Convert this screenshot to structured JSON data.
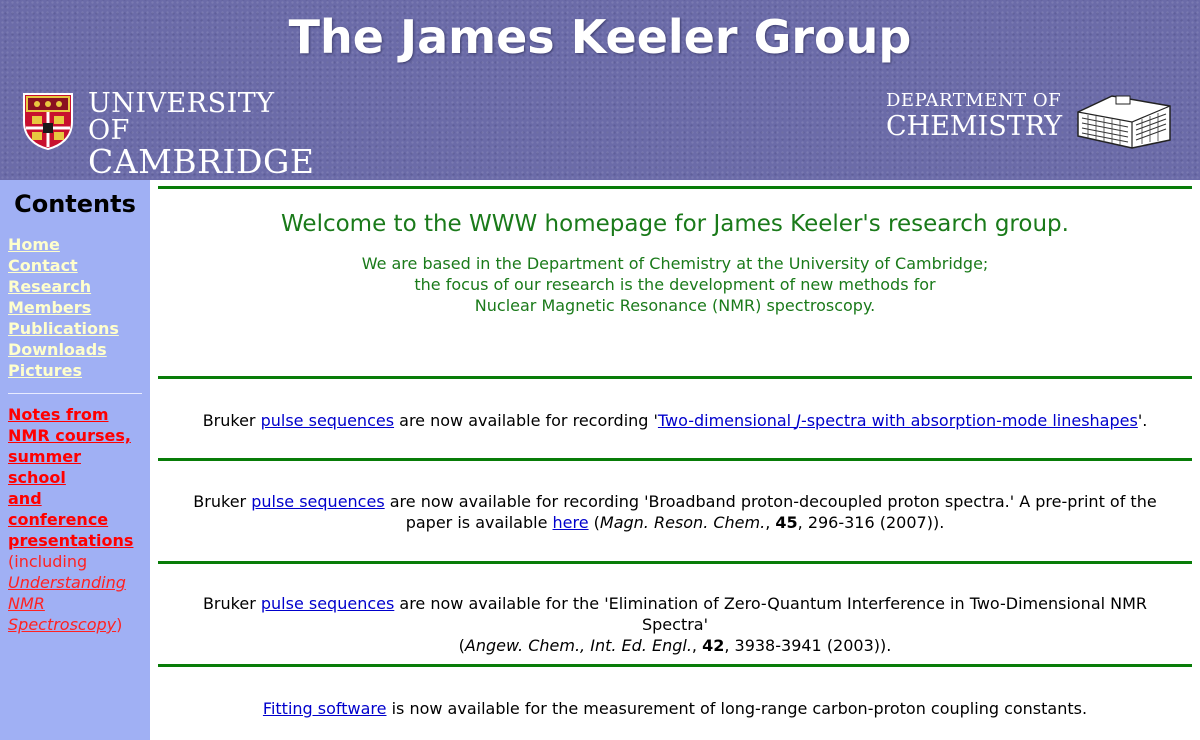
{
  "header": {
    "title": "The James Keeler Group",
    "university_line1": "UNIVERSITY OF",
    "university_line2": "CAMBRIDGE",
    "department_line1": "DEPARTMENT OF",
    "department_line2": "CHEMISTRY"
  },
  "sidebar": {
    "heading": "Contents",
    "items": [
      "Home",
      "Contact",
      "Research",
      "Members",
      "Publications",
      "Downloads",
      "Pictures"
    ],
    "notes": {
      "line1": "Notes from",
      "line2": "NMR courses,",
      "line3": "summer school",
      "line4": "and conference",
      "line5": "presentations",
      "including": "(including",
      "book1": "Understanding",
      "book2": "NMR",
      "book3": "Spectroscopy",
      "close": ")"
    }
  },
  "welcome": {
    "title": "Welcome to the WWW homepage for James Keeler's research group.",
    "line1": "We are based in the Department of Chemistry at the University of Cambridge;",
    "line2": "the focus of our research is the development of new methods for",
    "line3": "Nuclear Magnetic Resonance (NMR) spectroscopy."
  },
  "news": [
    {
      "pre": "Bruker ",
      "link": "pulse sequences",
      "mid": " are now available for recording '",
      "link2a": "Two-dimensional ",
      "link2b": "J",
      "link2c": "-spectra with absorption-mode lineshapes",
      "post": "'."
    },
    {
      "pre": "Bruker ",
      "link": "pulse sequences",
      "mid": " are now available for recording 'Broadband proton-decoupled proton spectra.' A pre-print of the paper is available ",
      "link2": "here",
      "open": " (",
      "journal": "Magn. Reson. Chem.",
      "comma": ", ",
      "volume": "45",
      "pages": ", 296-316 (2007))."
    },
    {
      "pre": "Bruker ",
      "link": "pulse sequences",
      "mid": " are now available for the 'Elimination of Zero-Quantum Interference in Two-Dimensional NMR Spectra'",
      "open": "(",
      "journal": "Angew. Chem., Int. Ed. Engl.",
      "comma": ", ",
      "volume": "42",
      "pages": ", 3938-3941 (2003))."
    },
    {
      "link": "Fitting software",
      "post": " is now available for the measurement of long-range carbon-proton coupling constants."
    }
  ],
  "colors": {
    "header_bg": "#6b6ba8",
    "sidebar_bg": "#a0b0f4",
    "rule_green": "#087c08",
    "welcome_green": "#1a7a1a",
    "nav_link": "#ffffcc",
    "notes_red": "#ff0000",
    "link_blue": "#0000cc"
  }
}
